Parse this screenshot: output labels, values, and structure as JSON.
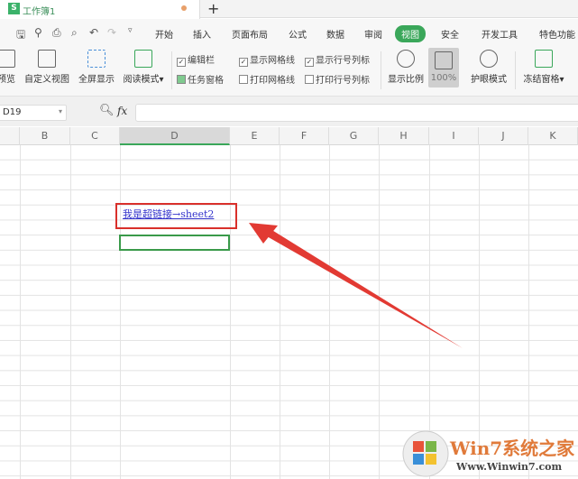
{
  "tab": {
    "title": "工作簿1",
    "logo": "S"
  },
  "quick_access": [
    "save-icon",
    "format-painter-icon",
    "print-icon",
    "print-preview-icon",
    "undo-icon",
    "redo-icon",
    "dropdown-icon"
  ],
  "menu": [
    "开始",
    "插入",
    "页面布局",
    "公式",
    "数据",
    "审阅",
    "视图",
    "安全",
    "开发工具",
    "特色功能"
  ],
  "active_menu": "视图",
  "ribbon": {
    "buttons": [
      "预览",
      "自定义视图",
      "全屏显示",
      "阅读模式",
      "显示比例",
      "100%",
      "护眼模式",
      "冻结窗格"
    ],
    "checks": [
      {
        "label": "编辑栏",
        "checked": true
      },
      {
        "label": "任务窗格",
        "checked": true
      },
      {
        "label": "显示网格线",
        "checked": true
      },
      {
        "label": "打印网格线",
        "checked": false
      },
      {
        "label": "显示行号列标",
        "checked": true
      },
      {
        "label": "打印行号列标",
        "checked": false
      }
    ]
  },
  "formula_bar": {
    "name_box": "D19",
    "fx": "fx",
    "value": ""
  },
  "columns": [
    "B",
    "C",
    "D",
    "E",
    "F",
    "G",
    "H",
    "I",
    "J",
    "K"
  ],
  "selected_column": "D",
  "cell_link": "我是超链接→sheet2",
  "watermark": {
    "title": "Win7系统之家",
    "url": "Www.Winwin7.com"
  },
  "colors": {
    "accent": "#3aa75a",
    "annotation": "#d9302b",
    "link": "#3333cc"
  }
}
